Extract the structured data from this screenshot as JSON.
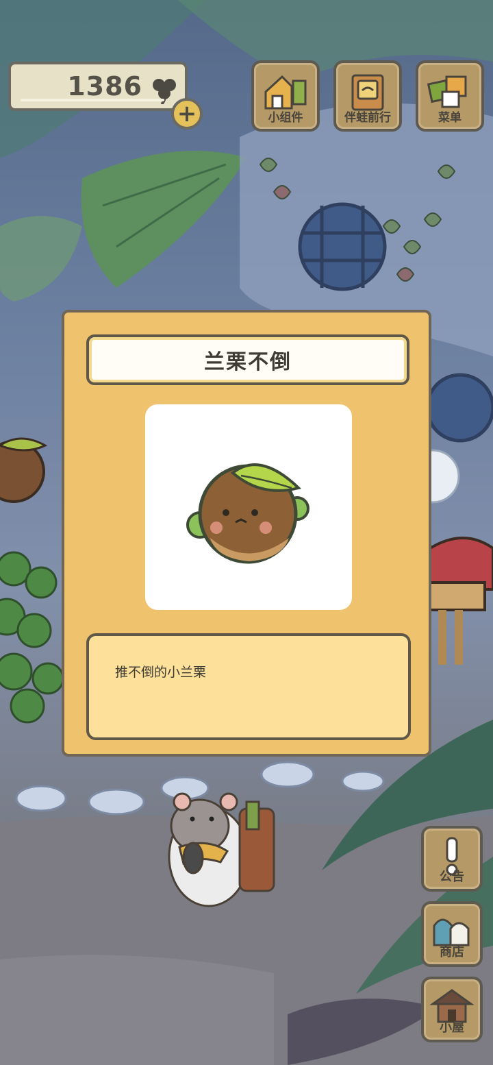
{
  "currency": {
    "amount": "1386",
    "icon": "clover-icon",
    "add_icon": "plus-icon"
  },
  "top_buttons": [
    {
      "label": "小组件",
      "icon": "widget-icon"
    },
    {
      "label": "伴蛙前行",
      "icon": "companion-book-icon"
    },
    {
      "label": "菜单",
      "icon": "menu-icon"
    }
  ],
  "side_buttons": [
    {
      "label": "公告",
      "icon": "exclamation-icon"
    },
    {
      "label": "商店",
      "icon": "shop-bags-icon"
    },
    {
      "label": "小屋",
      "icon": "house-icon"
    }
  ],
  "item_card": {
    "title": "兰栗不倒",
    "description": "推不倒的小兰栗",
    "image": "chestnut-tumbler-icon"
  },
  "colors": {
    "card_bg": "#efc36d",
    "desc_bg": "#fde19a",
    "wood": "#b59966"
  }
}
